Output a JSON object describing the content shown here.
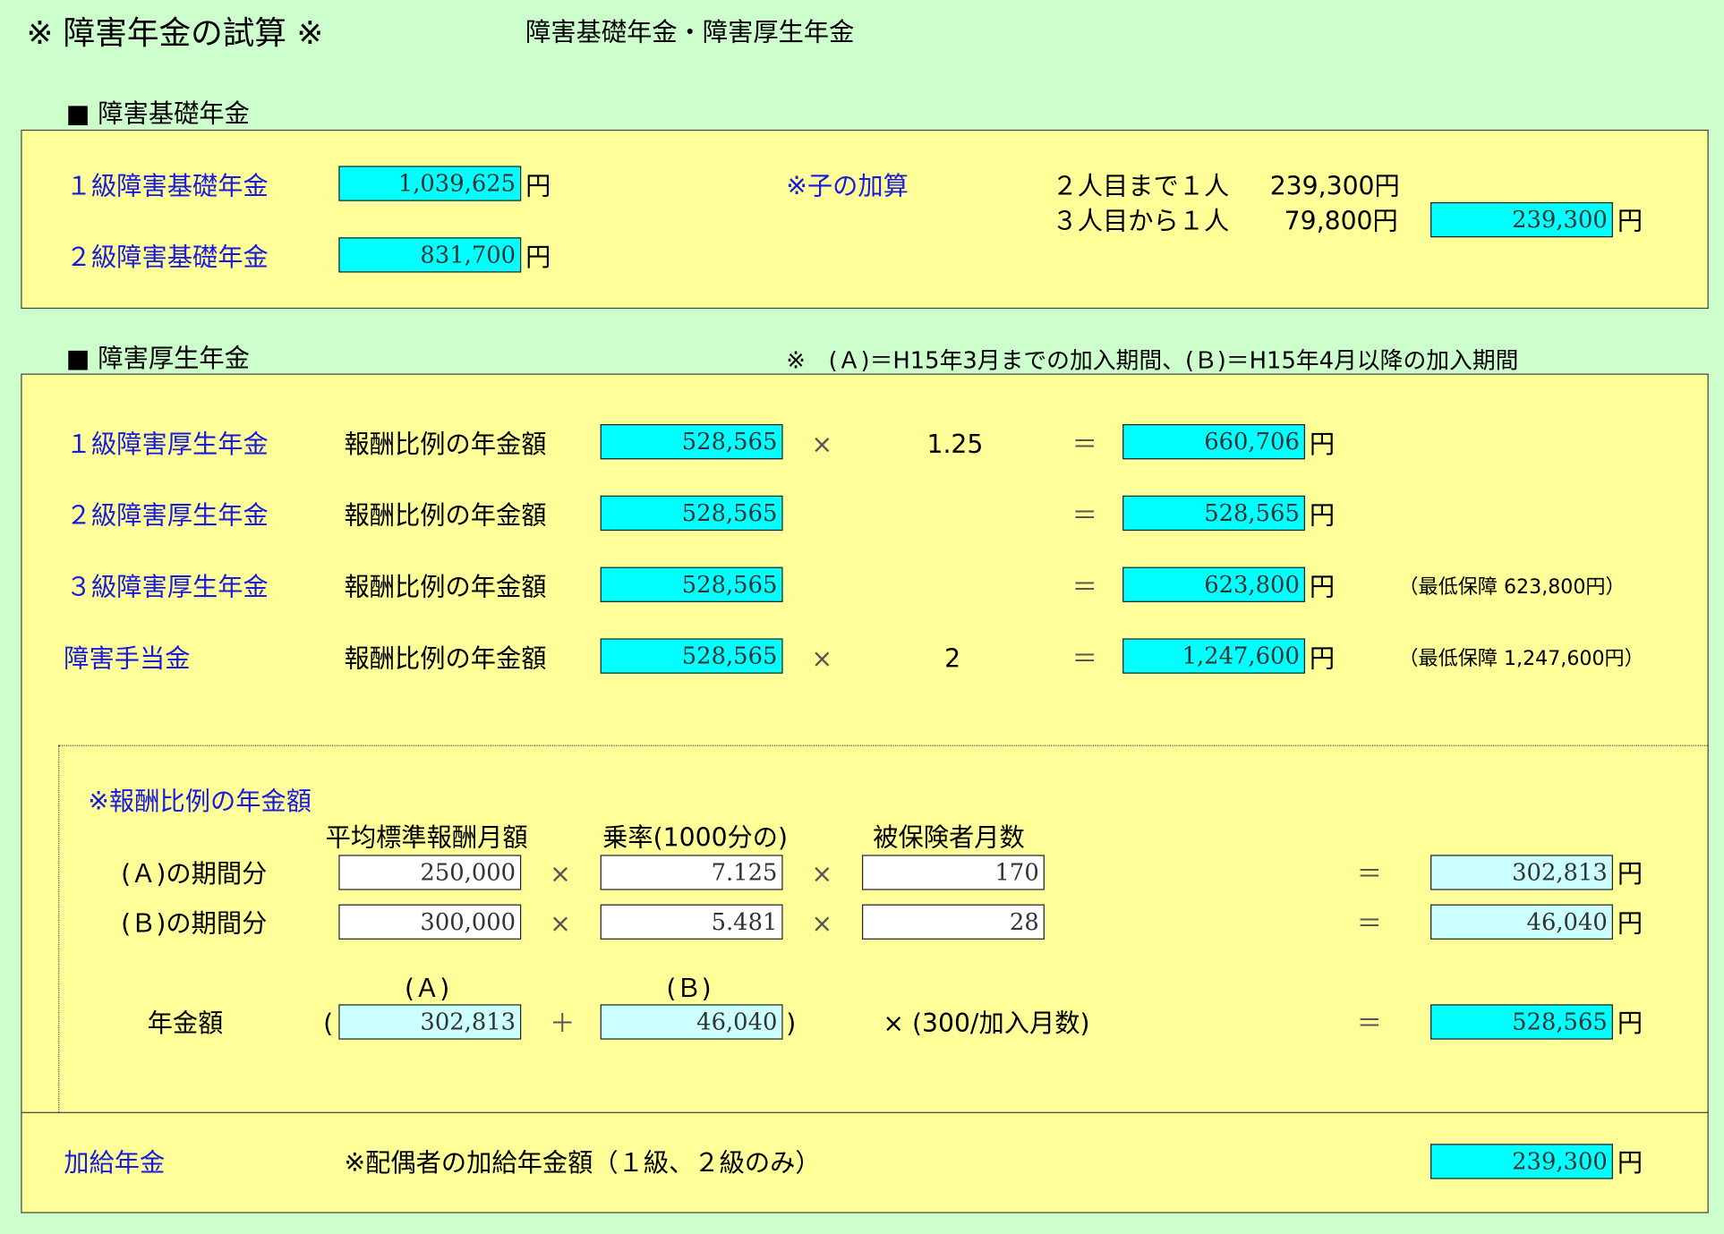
{
  "header": {
    "title": "※ 障害年金の試算 ※",
    "subtitle": "障害基礎年金・障害厚生年金"
  },
  "kiso": {
    "heading": "■ 障害基礎年金",
    "grade1_label": "１級障害基礎年金",
    "grade1_value": "1,039,625",
    "grade2_label": "２級障害基礎年金",
    "grade2_value": "831,700",
    "child_label": "※子の加算",
    "child_row1_label": "２人目まで１人",
    "child_row1_value": "239,300円",
    "child_row2_label": "３人目から１人",
    "child_row2_value": "79,800円",
    "child_total": "239,300"
  },
  "kosei": {
    "heading": "■ 障害厚生年金",
    "note": "※　(Ａ)＝H15年3月までの加入期間、(Ｂ)＝H15年4月以降の加入期間",
    "rows": [
      {
        "label": "１級障害厚生年金",
        "desc": "報酬比例の年金額",
        "base": "528,565",
        "times": "×",
        "factor": "1.25",
        "eq": "＝",
        "result": "660,706",
        "note": ""
      },
      {
        "label": "２級障害厚生年金",
        "desc": "報酬比例の年金額",
        "base": "528,565",
        "times": "",
        "factor": "",
        "eq": "＝",
        "result": "528,565",
        "note": ""
      },
      {
        "label": "３級障害厚生年金",
        "desc": "報酬比例の年金額",
        "base": "528,565",
        "times": "",
        "factor": "",
        "eq": "＝",
        "result": "623,800",
        "note": "（最低保障 623,800円）"
      },
      {
        "label": "障害手当金",
        "desc": "報酬比例の年金額",
        "base": "528,565",
        "times": "×",
        "factor": "2",
        "eq": "＝",
        "result": "1,247,600",
        "note": "（最低保障 1,247,600円）"
      }
    ]
  },
  "hoshu": {
    "heading": "※報酬比例の年金額",
    "col_avg": "平均標準報酬月額",
    "col_rate": "乗率(1000分の)",
    "col_months": "被保険者月数",
    "row_a_label": "(Ａ)の期間分",
    "row_a_avg": "250,000",
    "row_a_rate": "7.125",
    "row_a_months": "170",
    "row_a_result": "302,813",
    "row_b_label": "(Ｂ)の期間分",
    "row_b_avg": "300,000",
    "row_b_rate": "5.481",
    "row_b_months": "28",
    "row_b_result": "46,040",
    "sum_label": "年金額",
    "sum_a_head": "(Ａ)",
    "sum_b_head": "(Ｂ)",
    "sum_a": "302,813",
    "sum_b": "46,040",
    "open_paren": "(",
    "close_paren": ")",
    "plus": "＋",
    "multiplier": "× (300/加入月数)",
    "sum_result": "528,565"
  },
  "kakyu": {
    "label": "加給年金",
    "desc": "※配偶者の加給年金額（１級、２級のみ）",
    "value": "239,300"
  },
  "symbols": {
    "yen": "円",
    "times": "×",
    "eq": "＝"
  }
}
